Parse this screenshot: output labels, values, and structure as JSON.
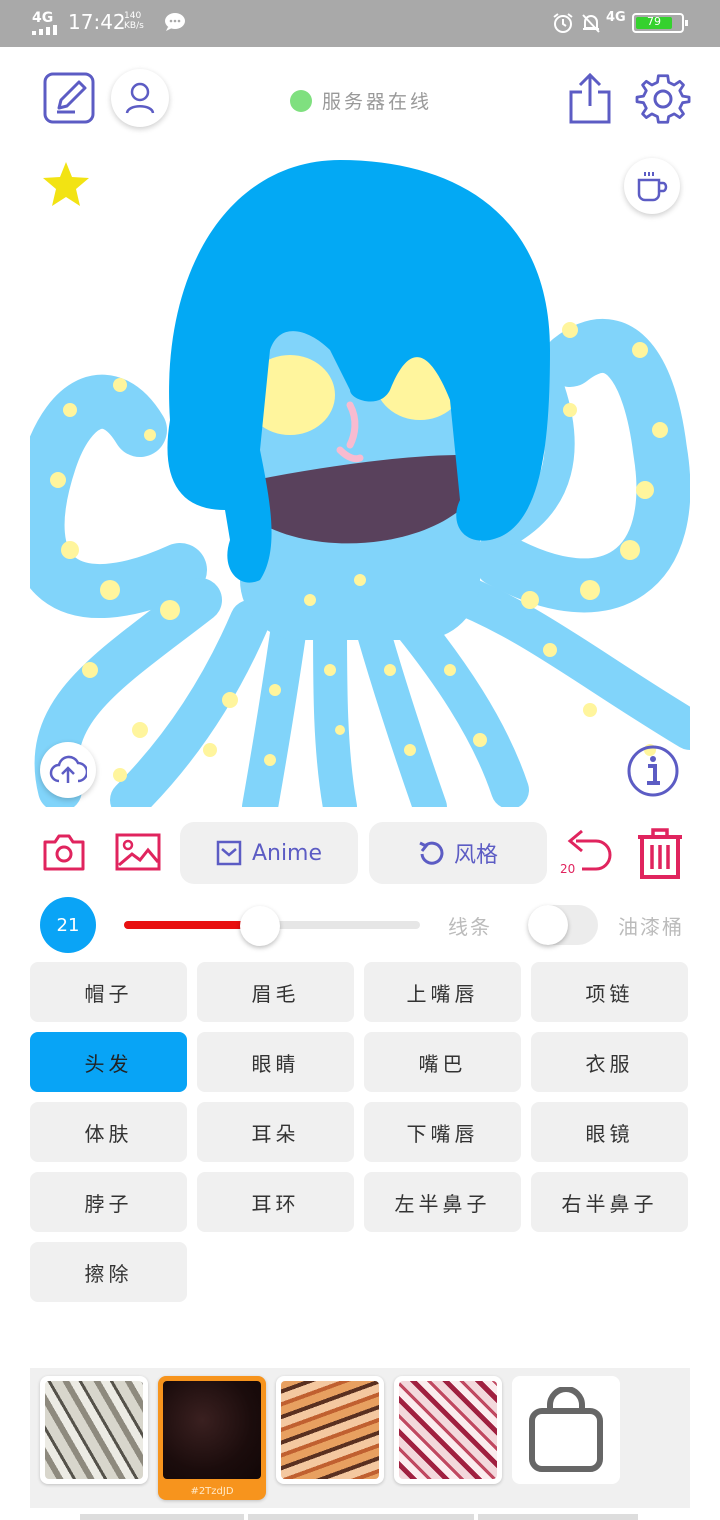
{
  "status_bar": {
    "network": "4G",
    "time": "17:42",
    "speed_value": "140",
    "speed_unit": "KB/s",
    "network_right": "4G",
    "battery": "79"
  },
  "header": {
    "server_status": "服务器在线"
  },
  "toolbar": {
    "anime_label": "Anime",
    "style_label": "风格",
    "undo_count": "20"
  },
  "brush": {
    "size": "21",
    "slider_value": 0.46,
    "line_label": "线条",
    "bucket_label": "油漆桶",
    "bucket_on": false
  },
  "parts": [
    {
      "label": "帽子",
      "active": false
    },
    {
      "label": "眉毛",
      "active": false
    },
    {
      "label": "上嘴唇",
      "active": false
    },
    {
      "label": "项链",
      "active": false
    },
    {
      "label": "头发",
      "active": true
    },
    {
      "label": "眼睛",
      "active": false
    },
    {
      "label": "嘴巴",
      "active": false
    },
    {
      "label": "衣服",
      "active": false
    },
    {
      "label": "体肤",
      "active": false
    },
    {
      "label": "耳朵",
      "active": false
    },
    {
      "label": "下嘴唇",
      "active": false
    },
    {
      "label": "眼镜",
      "active": false
    },
    {
      "label": "脖子",
      "active": false
    },
    {
      "label": "耳环",
      "active": false
    },
    {
      "label": "左半鼻子",
      "active": false
    },
    {
      "label": "右半鼻子",
      "active": false
    },
    {
      "label": "擦除",
      "active": false
    }
  ],
  "styles": {
    "selected_code": "#2TzdJD"
  },
  "colors": {
    "accent_purple": "#5c5cc4",
    "accent_red": "#e0245e",
    "active_blue": "#08a4f6",
    "hair_blue": "#03a9f4",
    "body_blue": "#81d4fa",
    "spot_yellow": "#fff59d"
  }
}
